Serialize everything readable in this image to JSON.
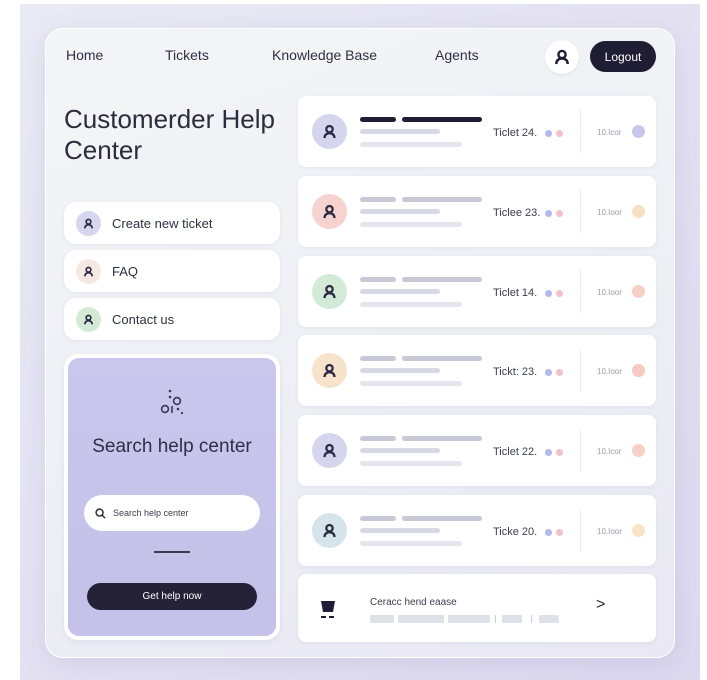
{
  "nav": {
    "home": "Home",
    "tickets": "Tickets",
    "knowledge_base": "Knowledge Base",
    "agents": "Agents",
    "logout": "Logout"
  },
  "page": {
    "title": "Customerder Help Center"
  },
  "menu": {
    "create": "Create new ticket",
    "faq": "FAQ",
    "contact": "Contact us"
  },
  "search": {
    "heading": "Search help center",
    "placeholder": "Search help center",
    "button": "Get help now"
  },
  "tickets": [
    {
      "label": "Ticlet 24.",
      "meta": "10.Icor",
      "avatar_bg": "#d6d5ee",
      "status_color": "#c8c6ec"
    },
    {
      "label": "Ticlee 23.",
      "meta": "10.Ioor",
      "avatar_bg": "#f7d3cf",
      "status_color": "#f7e0c4"
    },
    {
      "label": "Ticlet 14.",
      "meta": "10.Ioor",
      "avatar_bg": "#d3ead6",
      "status_color": "#f8cfc6"
    },
    {
      "label": "Tickt: 23.",
      "meta": "10.Ioor",
      "avatar_bg": "#f7e2cb",
      "status_color": "#f7c9c3"
    },
    {
      "label": "Ticlet 22.",
      "meta": "10.Icor",
      "avatar_bg": "#d6d5ee",
      "status_color": "#f7cfc6"
    },
    {
      "label": "Ticke 20.",
      "meta": "10.Ioor",
      "avatar_bg": "#d5e3ea",
      "status_color": "#f7e4c7"
    }
  ],
  "footer": {
    "text": "Ceracc hend eaase",
    "chevron": ">"
  },
  "colors": {
    "accent_dark": "#1f1d33",
    "search_panel": "#c6c3eb",
    "dot_blue": "#b7b8e6",
    "dot_pink": "#f3c1c9"
  }
}
